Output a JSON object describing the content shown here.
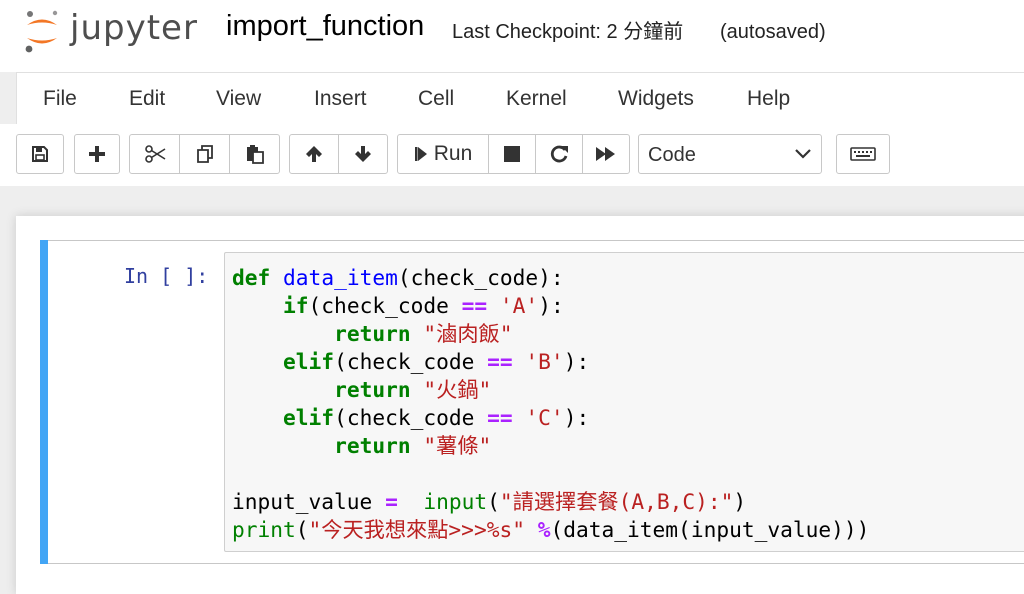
{
  "header": {
    "logo_text": "jupyter",
    "notebook_name": "import_function",
    "checkpoint": "Last Checkpoint: 2 分鐘前",
    "autosave": "(autosaved)"
  },
  "menubar": {
    "items": [
      "File",
      "Edit",
      "View",
      "Insert",
      "Cell",
      "Kernel",
      "Widgets",
      "Help"
    ]
  },
  "toolbar": {
    "save_icon": "save-icon",
    "add_icon": "plus-icon",
    "cut_icon": "scissors-icon",
    "copy_icon": "copy-icon",
    "paste_icon": "paste-icon",
    "up_icon": "arrow-up-icon",
    "down_icon": "arrow-down-icon",
    "run_label": "Run",
    "stop_icon": "stop-icon",
    "restart_icon": "restart-icon",
    "fast_forward_icon": "fast-forward-icon",
    "cell_type": "Code",
    "keyboard_icon": "keyboard-icon"
  },
  "cell": {
    "prompt": "In [ ]:",
    "accent_color": "#42a5f5",
    "code_lines": [
      [
        {
          "t": "def",
          "c": "kw"
        },
        {
          "t": " "
        },
        {
          "t": "data_item",
          "c": "fn"
        },
        {
          "t": "(check_code):"
        }
      ],
      [
        {
          "t": "    "
        },
        {
          "t": "if",
          "c": "kw"
        },
        {
          "t": "(check_code "
        },
        {
          "t": "==",
          "c": "op"
        },
        {
          "t": " "
        },
        {
          "t": "'A'",
          "c": "str"
        },
        {
          "t": "):"
        }
      ],
      [
        {
          "t": "        "
        },
        {
          "t": "return",
          "c": "kw"
        },
        {
          "t": " "
        },
        {
          "t": "\"滷肉飯\"",
          "c": "str"
        }
      ],
      [
        {
          "t": "    "
        },
        {
          "t": "elif",
          "c": "kw"
        },
        {
          "t": "(check_code "
        },
        {
          "t": "==",
          "c": "op"
        },
        {
          "t": " "
        },
        {
          "t": "'B'",
          "c": "str"
        },
        {
          "t": "):"
        }
      ],
      [
        {
          "t": "        "
        },
        {
          "t": "return",
          "c": "kw"
        },
        {
          "t": " "
        },
        {
          "t": "\"火鍋\"",
          "c": "str"
        }
      ],
      [
        {
          "t": "    "
        },
        {
          "t": "elif",
          "c": "kw"
        },
        {
          "t": "(check_code "
        },
        {
          "t": "==",
          "c": "op"
        },
        {
          "t": " "
        },
        {
          "t": "'C'",
          "c": "str"
        },
        {
          "t": "):"
        }
      ],
      [
        {
          "t": "        "
        },
        {
          "t": "return",
          "c": "kw"
        },
        {
          "t": " "
        },
        {
          "t": "\"薯條\"",
          "c": "str"
        }
      ],
      [
        {
          "t": ""
        }
      ],
      [
        {
          "t": "input_value "
        },
        {
          "t": "=",
          "c": "op"
        },
        {
          "t": "  "
        },
        {
          "t": "input",
          "c": "bi"
        },
        {
          "t": "("
        },
        {
          "t": "\"請選擇套餐(A,B,C):\"",
          "c": "str"
        },
        {
          "t": ")"
        }
      ],
      [
        {
          "t": "print",
          "c": "bi"
        },
        {
          "t": "("
        },
        {
          "t": "\"今天我想來點>>>%s\"",
          "c": "str"
        },
        {
          "t": " "
        },
        {
          "t": "%",
          "c": "op"
        },
        {
          "t": "(data_item(input_value)))"
        }
      ]
    ]
  }
}
